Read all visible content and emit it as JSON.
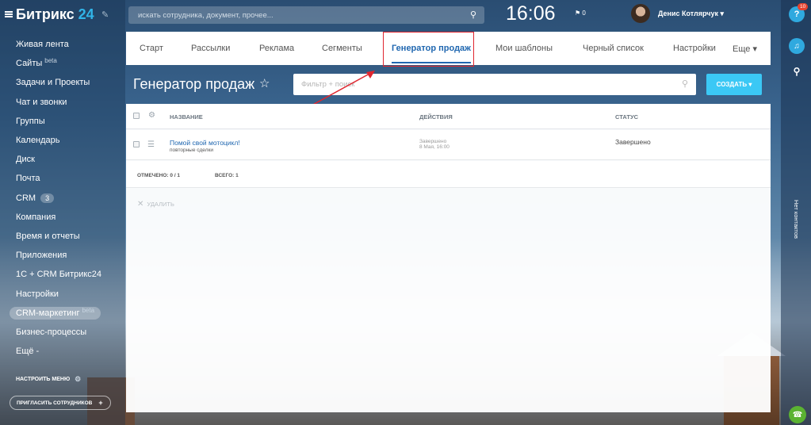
{
  "app": {
    "logo_name": "Битрикс",
    "logo_number": "24"
  },
  "sidebar": {
    "items": [
      {
        "label": "Живая лента"
      },
      {
        "label": "Сайты",
        "sup": "beta"
      },
      {
        "label": "Задачи и Проекты"
      },
      {
        "label": "Чат и звонки"
      },
      {
        "label": "Группы"
      },
      {
        "label": "Календарь"
      },
      {
        "label": "Диск"
      },
      {
        "label": "Почта"
      },
      {
        "label": "CRM",
        "count": "3"
      },
      {
        "label": "Компания"
      },
      {
        "label": "Время и отчеты"
      },
      {
        "label": "Приложения"
      },
      {
        "label": "1С + CRM Битрикс24"
      },
      {
        "label": "Настройки"
      },
      {
        "label": "CRM-маркетинг",
        "sup": "beta"
      },
      {
        "label": "Бизнес-процессы"
      },
      {
        "label": "Ещё -"
      }
    ],
    "setup_menu": "НАСТРОИТЬ МЕНЮ",
    "invite": "ПРИГЛАСИТЬ СОТРУДНИКОВ"
  },
  "topbar": {
    "search_placeholder": "искать сотрудника, документ, прочее...",
    "clock": "16:06",
    "flag_count": "0",
    "user_name": "Денис Котлярчук"
  },
  "rightbar": {
    "help_badge": "10",
    "no_contacts": "Нет контактов"
  },
  "tabs": [
    {
      "label": "Старт"
    },
    {
      "label": "Рассылки"
    },
    {
      "label": "Реклама"
    },
    {
      "label": "Сегменты"
    },
    {
      "label": "Генератор продаж"
    },
    {
      "label": "Мои шаблоны"
    },
    {
      "label": "Черный список"
    },
    {
      "label": "Настройки"
    },
    {
      "label": "Еще"
    }
  ],
  "page": {
    "title": "Генератор продаж",
    "filter_placeholder": "Фильтр + поиск",
    "create_label": "СОЗДАТЬ"
  },
  "grid": {
    "columns": {
      "name": "НАЗВАНИЕ",
      "actions": "ДЕЙСТВИЯ",
      "status": "СТАТУС"
    },
    "rows": [
      {
        "name": "Помой свой мотоцикл!",
        "subtitle": "повторные сделки",
        "action_state": "Завершено",
        "action_date": "8 Мая, 16:00",
        "status": "Завершено"
      }
    ],
    "footer": {
      "selected": "ОТМЕЧЕНО: 0 / 1",
      "total": "ВСЕГО: 1"
    },
    "delete_label": "УДАЛИТЬ"
  },
  "colors": {
    "accent": "#2067b0",
    "create_button": "#3bc8f5",
    "highlight": "#e0262f"
  }
}
